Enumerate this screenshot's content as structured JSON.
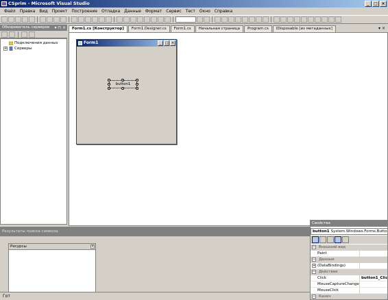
{
  "window": {
    "title": "CSprim - Microsoft Visual Studio",
    "buttons": [
      "_",
      "□",
      "×"
    ]
  },
  "menu": [
    "Файл",
    "Правка",
    "Вид",
    "Проект",
    "Построение",
    "Отладка",
    "Данные",
    "Формат",
    "Сервис",
    "Тест",
    "Окно",
    "Справка"
  ],
  "server_explorer": {
    "title": "Обозреватель серверов",
    "controls": "▾ ⊓ ×",
    "items": [
      {
        "label": "Подключения данных",
        "expander": "",
        "icon": "database-folder-icon"
      },
      {
        "label": "Серверы",
        "expander": "+",
        "icon": "servers-icon"
      }
    ]
  },
  "tabs": [
    {
      "label": "Form1.cs [Конструктор]",
      "active": true
    },
    {
      "label": "Form1.Designer.cs",
      "active": false
    },
    {
      "label": "Form1.cs",
      "active": false
    },
    {
      "label": "Начальная страница",
      "active": false
    },
    {
      "label": "Program.cs",
      "active": false
    },
    {
      "label": "IDisposable [из метаданных]",
      "active": false
    }
  ],
  "tab_controls": "▾ ×",
  "designer": {
    "form_title": "Form1",
    "form_buttons": [
      "_",
      "□",
      "×"
    ],
    "button_text": "button1"
  },
  "output": {
    "title": "Результаты поиска символа"
  },
  "resources": {
    "title": "Ресурсы",
    "close": "×"
  },
  "statusbar": {
    "text": "Гот"
  },
  "properties": {
    "title": "Свойства",
    "object_name": "button1",
    "object_type": "System.Windows.Forms.Button",
    "rows": [
      {
        "kind": "cat",
        "key": "Внешний вид",
        "exp": "−"
      },
      {
        "kind": "prop",
        "key": "Paint",
        "value": ""
      },
      {
        "kind": "cat",
        "key": "Данные",
        "exp": "−"
      },
      {
        "kind": "prop",
        "key": "(DataBindings)",
        "value": "",
        "exp": "+"
      },
      {
        "kind": "cat",
        "key": "Действие",
        "exp": "−"
      },
      {
        "kind": "prop",
        "key": "Click",
        "value": "button1_Click"
      },
      {
        "kind": "prop",
        "key": "MouseCaptureChanged",
        "value": ""
      },
      {
        "kind": "prop",
        "key": "MouseClick",
        "value": ""
      },
      {
        "kind": "cat",
        "key": "Канеч",
        "exp": "−"
      }
    ]
  },
  "colors": {
    "title_gradient_start": "#0a246a",
    "title_gradient_end": "#a6caf0",
    "chrome": "#d4d0c8"
  }
}
